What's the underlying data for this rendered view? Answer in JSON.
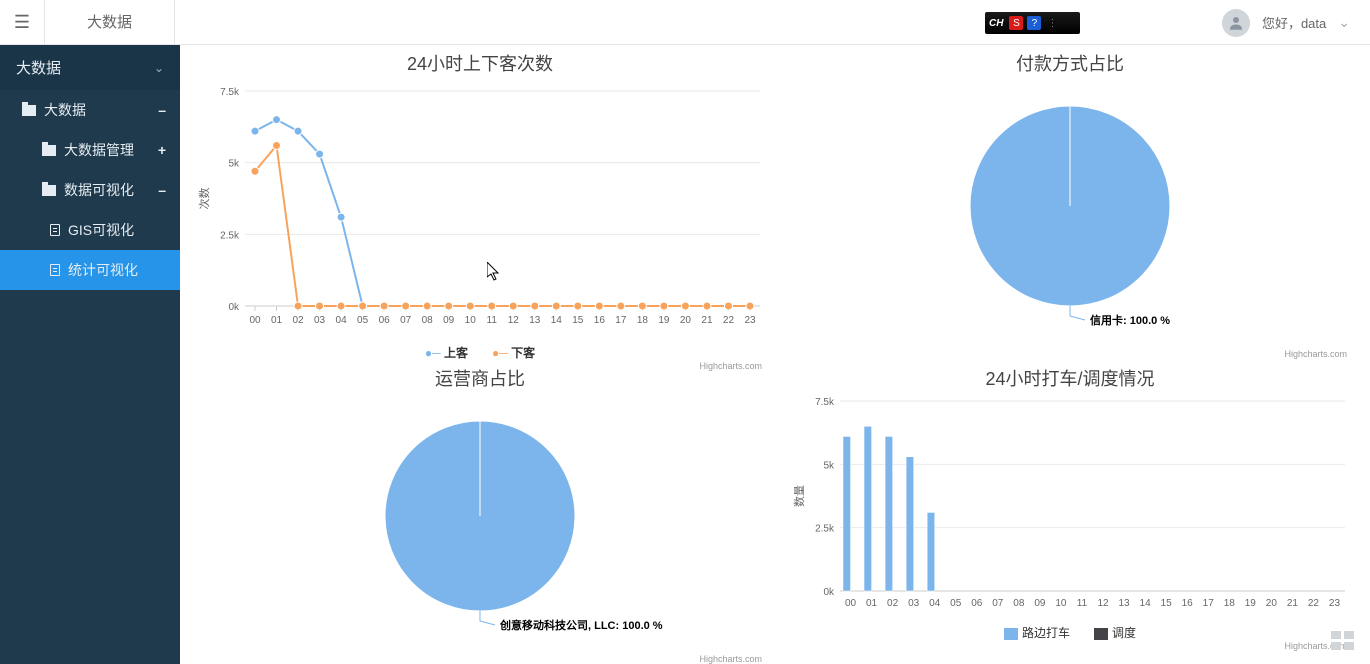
{
  "header": {
    "title": "大数据",
    "greeting": "您好，data",
    "ime": {
      "label": "CH",
      "icons": [
        "S",
        "?"
      ]
    }
  },
  "sidebar": {
    "root": "大数据",
    "items": [
      {
        "label": "大数据",
        "toggle": "–"
      },
      {
        "label": "大数据管理",
        "toggle": "+"
      },
      {
        "label": "数据可视化",
        "toggle": "–"
      },
      {
        "label": "GIS可视化"
      },
      {
        "label": "统计可视化",
        "active": true
      }
    ]
  },
  "charts": {
    "hourly": {
      "title": "24小时上下客次数",
      "ylabel": "次数",
      "legend": [
        "上客",
        "下客"
      ],
      "credits": "Highcharts.com"
    },
    "payment": {
      "title": "付款方式占比",
      "slice_label": "信用卡: 100.0 %",
      "credits": "Highcharts.com"
    },
    "operator": {
      "title": "运营商占比",
      "slice_label": "创意移动科技公司, LLC: 100.0 %",
      "credits": "Highcharts.com"
    },
    "dispatch": {
      "title": "24小时打车/调度情况",
      "ylabel": "数量",
      "legend": [
        "路边打车",
        "调度"
      ],
      "credits": "Highcharts.com"
    }
  },
  "chart_data": [
    {
      "type": "line",
      "title": "24小时上下客次数",
      "ylabel": "次数",
      "ylim": [
        0,
        7500
      ],
      "yticks": [
        0,
        2500,
        5000,
        7500
      ],
      "categories": [
        "00",
        "01",
        "02",
        "03",
        "04",
        "05",
        "06",
        "07",
        "08",
        "09",
        "10",
        "11",
        "12",
        "13",
        "14",
        "15",
        "16",
        "17",
        "18",
        "19",
        "20",
        "21",
        "22",
        "23"
      ],
      "series": [
        {
          "name": "上客",
          "color": "#7cb5ec",
          "values": [
            6100,
            6500,
            6100,
            5300,
            3100,
            0,
            0,
            0,
            0,
            0,
            0,
            0,
            0,
            0,
            0,
            0,
            0,
            0,
            0,
            0,
            0,
            0,
            0,
            0
          ]
        },
        {
          "name": "下客",
          "color": "#f7a35c",
          "values": [
            4700,
            5600,
            0,
            0,
            0,
            0,
            0,
            0,
            0,
            0,
            0,
            0,
            0,
            0,
            0,
            0,
            0,
            0,
            0,
            0,
            0,
            0,
            0,
            0
          ]
        }
      ]
    },
    {
      "type": "pie",
      "title": "付款方式占比",
      "series": [
        {
          "name": "信用卡",
          "value": 100.0,
          "color": "#7cb5ec"
        }
      ]
    },
    {
      "type": "pie",
      "title": "运营商占比",
      "series": [
        {
          "name": "创意移动科技公司, LLC",
          "value": 100.0,
          "color": "#7cb5ec"
        }
      ]
    },
    {
      "type": "bar",
      "title": "24小时打车/调度情况",
      "ylabel": "数量",
      "ylim": [
        0,
        7500
      ],
      "yticks": [
        0,
        2500,
        5000,
        7500
      ],
      "categories": [
        "00",
        "01",
        "02",
        "03",
        "04",
        "05",
        "06",
        "07",
        "08",
        "09",
        "10",
        "11",
        "12",
        "13",
        "14",
        "15",
        "16",
        "17",
        "18",
        "19",
        "20",
        "21",
        "22",
        "23"
      ],
      "series": [
        {
          "name": "路边打车",
          "color": "#7cb5ec",
          "values": [
            6100,
            6500,
            6100,
            5300,
            3100,
            0,
            0,
            0,
            0,
            0,
            0,
            0,
            0,
            0,
            0,
            0,
            0,
            0,
            0,
            0,
            0,
            0,
            0,
            0
          ]
        },
        {
          "name": "调度",
          "color": "#434348",
          "values": [
            0,
            0,
            0,
            0,
            0,
            0,
            0,
            0,
            0,
            0,
            0,
            0,
            0,
            0,
            0,
            0,
            0,
            0,
            0,
            0,
            0,
            0,
            0,
            0
          ]
        }
      ]
    }
  ]
}
